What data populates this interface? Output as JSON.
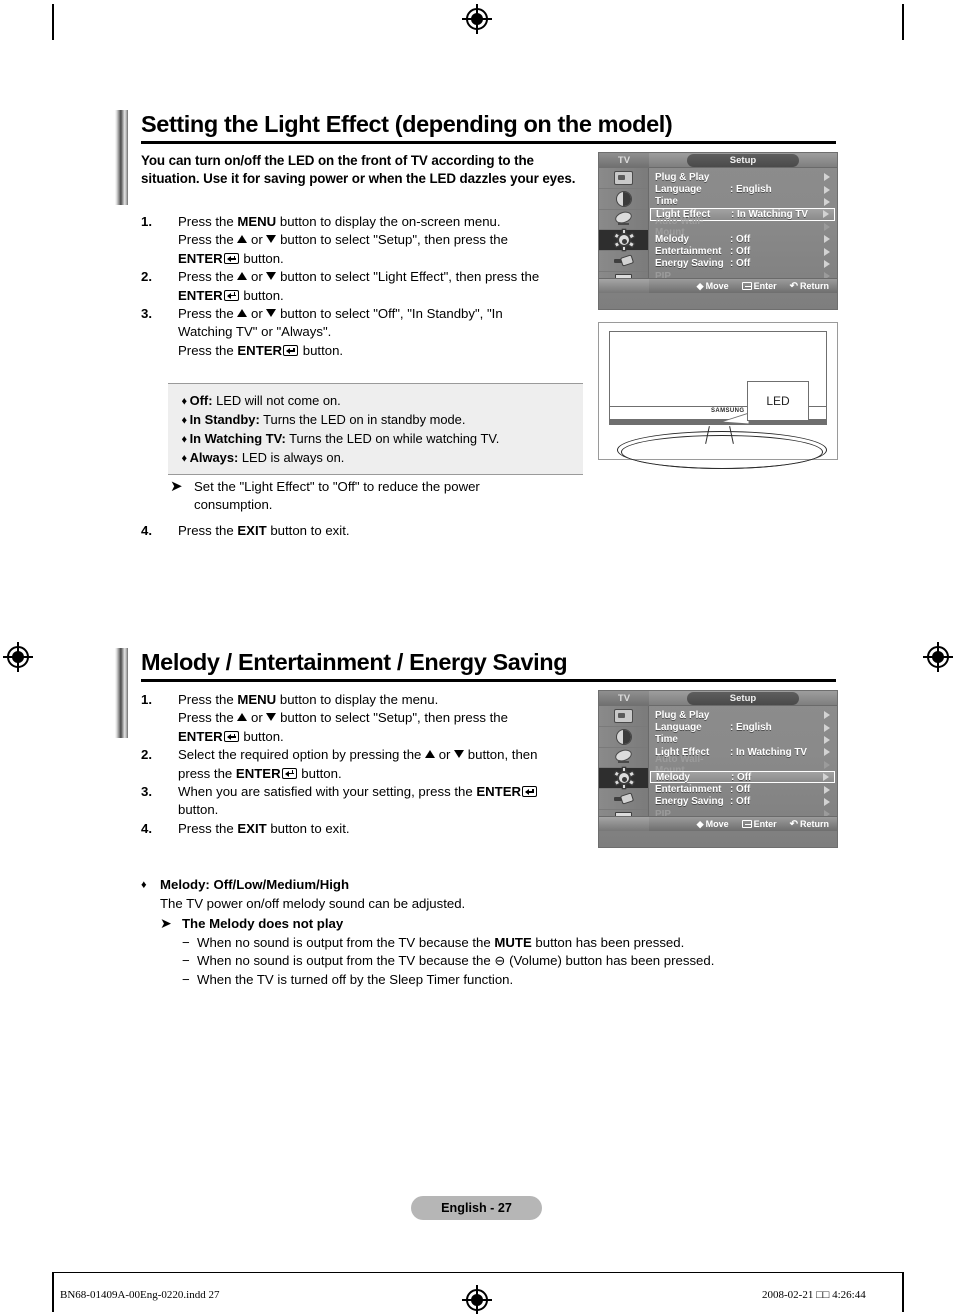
{
  "page": {
    "footer_label": "English - 27",
    "print_file": "BN68-01409A-00Eng-0220.indd   27",
    "print_timestamp": "2008-02-21   □□ 4:26:44"
  },
  "section1": {
    "heading": "Setting the Light Effect (depending on the model)",
    "intro": "You can turn on/off the LED on the front of TV according to the situation. Use it for saving power or when the LED dazzles your eyes.",
    "steps": [
      {
        "num": "1.",
        "lines": [
          "Press the <b>MENU</b> button to display the on-screen menu.",
          "Press the ▲ or ▼ button to select \"Setup\", then press the",
          "<b>ENTER</b><ENT> button."
        ]
      },
      {
        "num": "2.",
        "lines": [
          "Press the ▲ or ▼ button to select \"Light Effect\", then press the",
          "<b>ENTER</b><ENT> button."
        ]
      },
      {
        "num": "3.",
        "lines": [
          "Press the ▲ or ▼ button to select \"Off\", \"In Standby\", \"In",
          "Watching TV\" or \"Always\".",
          "Press the <b>ENTER</b><ENT> button."
        ]
      }
    ],
    "options": [
      {
        "term": "Off:",
        "desc": "LED will not come on."
      },
      {
        "term": "In Standby:",
        "desc": "Turns the LED on in standby mode."
      },
      {
        "term": "In Watching TV:",
        "desc": "Turns the LED on while watching TV."
      },
      {
        "term": "Always:",
        "desc": "LED is always on."
      }
    ],
    "note": "Set the \"Light Effect\" to \"Off\" to reduce the power consumption.",
    "step4": {
      "num": "4.",
      "text_pre": "Press the ",
      "bold": "EXIT",
      "text_post": " button to exit."
    }
  },
  "section2": {
    "heading": "Melody / Entertainment / Energy Saving",
    "steps": [
      {
        "num": "1.",
        "lines": [
          "Press the <b>MENU</b> button to display the menu.",
          "Press the ▲ or ▼ button to select \"Setup\", then press the",
          "<b>ENTER</b><ENT> button."
        ]
      },
      {
        "num": "2.",
        "lines": [
          "Select the required option by pressing the ▲ or ▼ button, then",
          "press the <b>ENTER</b><ENT> button."
        ]
      },
      {
        "num": "3.",
        "lines": [
          "When you are satisfied with your setting, press the <b>ENTER</b><ENT>",
          "button."
        ]
      },
      {
        "num": "4.",
        "lines": [
          "Press the <b>EXIT</b> button to exit."
        ]
      }
    ],
    "bullet_title": "Melody: Off/Low/Medium/High",
    "bullet_sub": "The TV power on/off melody sound can be adjusted.",
    "note_title": "The Melody does not play",
    "note_items": [
      "When no sound is output from the TV because the <b>MUTE</b> button has been pressed.",
      "When no sound is output from the TV because the ⊖ (Volume) button has been pressed.",
      "When the TV is turned off by the Sleep Timer function."
    ]
  },
  "osd1": {
    "tv_label": "TV",
    "title": "Setup",
    "rows": [
      {
        "label": "Plug & Play",
        "value": "",
        "state": "normal"
      },
      {
        "label": "Language",
        "value": ": English",
        "state": "normal"
      },
      {
        "label": "Time",
        "value": "",
        "state": "normal"
      },
      {
        "label": "Light Effect",
        "value": ": In Watching TV",
        "state": "selected"
      },
      {
        "label": "Auto Wall-Mount",
        "value": "",
        "state": "dim"
      },
      {
        "label": "Melody",
        "value": ": Off",
        "state": "normal"
      },
      {
        "label": "Entertainment",
        "value": ": Off",
        "state": "normal"
      },
      {
        "label": "Energy Saving",
        "value": ": Off",
        "state": "normal"
      },
      {
        "label": "PIP",
        "value": "",
        "state": "dim"
      }
    ],
    "footer": {
      "move": "Move",
      "enter": "Enter",
      "return": "Return"
    }
  },
  "osd2": {
    "tv_label": "TV",
    "title": "Setup",
    "rows": [
      {
        "label": "Plug & Play",
        "value": "",
        "state": "normal"
      },
      {
        "label": "Language",
        "value": ": English",
        "state": "normal"
      },
      {
        "label": "Time",
        "value": "",
        "state": "normal"
      },
      {
        "label": "Light Effect",
        "value": ": In Watching TV",
        "state": "normal"
      },
      {
        "label": "Auto Wall-Mount",
        "value": "",
        "state": "dim"
      },
      {
        "label": "Melody",
        "value": ": Off",
        "state": "selected"
      },
      {
        "label": "Entertainment",
        "value": ": Off",
        "state": "normal"
      },
      {
        "label": "Energy Saving",
        "value": ": Off",
        "state": "normal"
      },
      {
        "label": "PIP",
        "value": "",
        "state": "dim"
      }
    ],
    "footer": {
      "move": "Move",
      "enter": "Enter",
      "return": "Return"
    }
  },
  "tv_picture": {
    "brand": "SAMSUNG",
    "callout": "LED"
  },
  "icons": {
    "sidebar": [
      "picture-icon",
      "sound-icon",
      "channel-dish-icon",
      "setup-gear-icon",
      "input-plug-icon",
      "pip-list-icon"
    ]
  }
}
